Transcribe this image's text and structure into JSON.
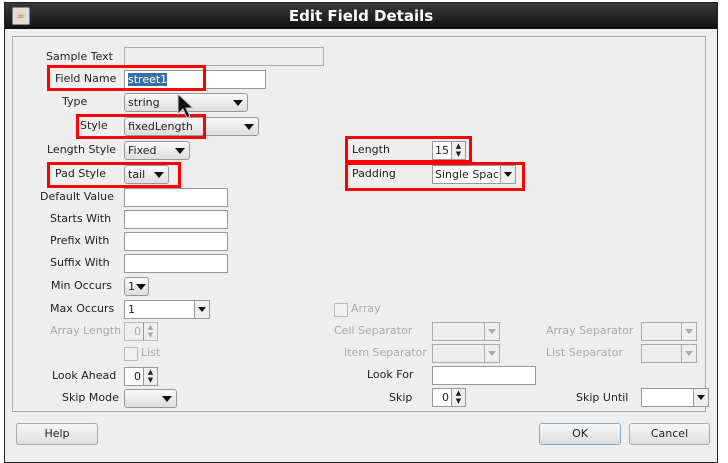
{
  "window": {
    "title": "Edit Field Details"
  },
  "fields": {
    "sample_text": {
      "label": "Sample Text",
      "value": ""
    },
    "field_name": {
      "label": "Field Name",
      "value": "street1"
    },
    "type": {
      "label": "Type",
      "value": "string"
    },
    "style": {
      "label": "Style",
      "value": "fixedLength"
    },
    "length_style": {
      "label": "Length Style",
      "value": "Fixed"
    },
    "pad_style": {
      "label": "Pad Style",
      "value": "tail"
    },
    "default_value": {
      "label": "Default Value",
      "value": ""
    },
    "starts_with": {
      "label": "Starts With",
      "value": ""
    },
    "prefix_with": {
      "label": "Prefix With",
      "value": ""
    },
    "suffix_with": {
      "label": "Suffix With",
      "value": ""
    },
    "min_occurs": {
      "label": "Min Occurs",
      "value": "1"
    },
    "max_occurs": {
      "label": "Max Occurs",
      "value": "1"
    },
    "array_length": {
      "label": "Array Length",
      "value": "0"
    },
    "list": {
      "label": "List",
      "checked": false
    },
    "look_ahead": {
      "label": "Look Ahead",
      "value": "0"
    },
    "skip_mode": {
      "label": "Skip Mode",
      "value": ""
    },
    "length": {
      "label": "Length",
      "value": "15"
    },
    "padding": {
      "label": "Padding",
      "value": "Single Space"
    },
    "array": {
      "label": "Array",
      "checked": false
    },
    "cell_separator": {
      "label": "Cell Separator",
      "value": ""
    },
    "item_separator": {
      "label": "Item Separator",
      "value": ""
    },
    "array_separator": {
      "label": "Array Separator",
      "value": ""
    },
    "list_separator": {
      "label": "List Separator",
      "value": ""
    },
    "look_for": {
      "label": "Look For",
      "value": ""
    },
    "skip": {
      "label": "Skip",
      "value": "0"
    },
    "skip_until": {
      "label": "Skip Until",
      "value": ""
    }
  },
  "buttons": {
    "help": "Help",
    "ok": "OK",
    "cancel": "Cancel"
  },
  "colors": {
    "highlight": "#ff0000",
    "title_bar": "#1a1a1a"
  }
}
